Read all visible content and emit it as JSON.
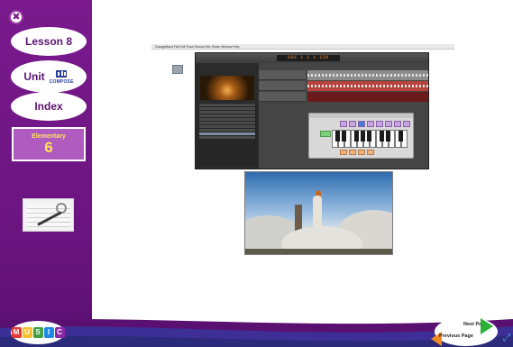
{
  "sidebar": {
    "close_glyph": "✖",
    "lesson_label": "Lesson 8",
    "unit_label": "Unit",
    "unit_sub": "COMPOSE",
    "index_label": "Index",
    "grade_label": "Elementary",
    "grade_number": "6",
    "thumbnail_icon": "notebook-pen-icon"
  },
  "logo": {
    "letters": [
      "M",
      "U",
      "S",
      "I",
      "C"
    ],
    "letter_colors": [
      "#e53935",
      "#fbc02d",
      "#43a047",
      "#1e88e5",
      "#8e24aa"
    ]
  },
  "screenshot": {
    "menubar_text": "GarageBand  File  Edit  Track  Record  Mix  Share  Window  Help",
    "lcd_text": "001 1 1 1  120"
  },
  "navigation": {
    "next_label": "Next Page",
    "prev_label": "Previous Page",
    "expand_glyph": "⤢"
  },
  "colors": {
    "sidebar_purple": "#6d1583",
    "grade_yellow": "#ffe25a",
    "next_green": "#2db035",
    "prev_orange": "#f08a24"
  }
}
